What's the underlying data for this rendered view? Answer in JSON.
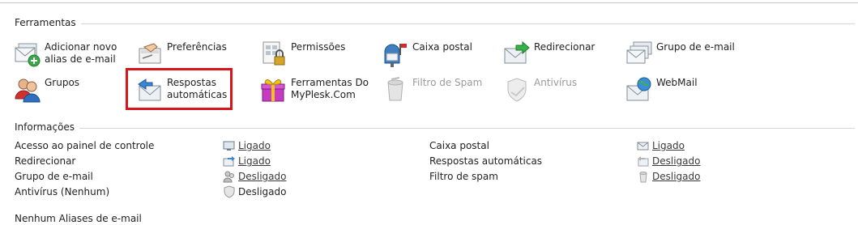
{
  "tools_section": {
    "title": "Ferramentas"
  },
  "tools": [
    {
      "label": "Adicionar novo\nalias de e-mail"
    },
    {
      "label": "Preferências"
    },
    {
      "label": "Permissões"
    },
    {
      "label": "Caixa postal"
    },
    {
      "label": "Redirecionar"
    },
    {
      "label": "Grupo de e-mail"
    },
    {
      "label": "Grupos"
    },
    {
      "label": "Respostas\nautomáticas"
    },
    {
      "label": "Ferramentas Do\nMyPlesk.Com"
    },
    {
      "label": "Filtro de Spam"
    },
    {
      "label": "Antivírus"
    },
    {
      "label": "WebMail"
    }
  ],
  "info_section": {
    "title": "Informações"
  },
  "info_left": [
    {
      "label": "Acesso ao painel de controle",
      "value": "Ligado"
    },
    {
      "label": "Redirecionar",
      "value": "Ligado"
    },
    {
      "label": "Grupo de e-mail",
      "value": "Desligado"
    },
    {
      "label": "Antivírus (Nenhum)",
      "value": "Desligado"
    }
  ],
  "info_right": [
    {
      "label": "Caixa postal",
      "value": "Ligado"
    },
    {
      "label": "Respostas automáticas",
      "value": "Desligado"
    },
    {
      "label": "Filtro de spam",
      "value": "Desligado"
    }
  ],
  "footer": {
    "text": "Nenhum Aliases de e-mail"
  },
  "colors": {
    "highlight": "#d8151a",
    "link": "#3a3a3a",
    "disabled": "#9a9a9a"
  }
}
